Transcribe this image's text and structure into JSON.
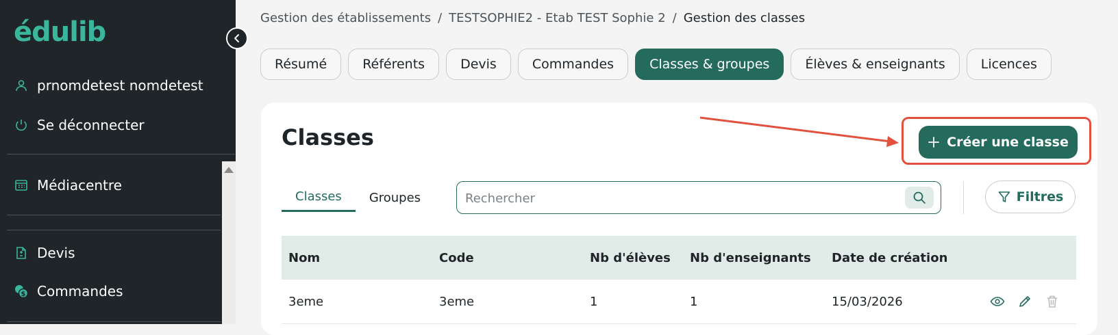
{
  "sidebar": {
    "logo": "édulib",
    "user": "prnomdetest nomdetest",
    "logout": "Se déconnecter",
    "items": [
      {
        "label": "Médiacentre",
        "icon": "catalog-icon"
      },
      {
        "label": "Devis",
        "icon": "quote-document-icon"
      },
      {
        "label": "Commandes",
        "icon": "coins-icon"
      }
    ]
  },
  "breadcrumb": [
    "Gestion des établissements",
    "/",
    "TESTSOPHIE2 - Etab TEST Sophie 2",
    "/",
    "Gestion des classes"
  ],
  "tabs": [
    "Résumé",
    "Référents",
    "Devis",
    "Commandes",
    "Classes & groupes",
    "Élèves & enseignants",
    "Licences"
  ],
  "active_tab": "Classes & groupes",
  "card": {
    "title": "Classes",
    "create_button": "Créer une classe",
    "subtabs": [
      "Classes",
      "Groupes"
    ],
    "search_placeholder": "Rechercher",
    "filter_button": "Filtres"
  },
  "table": {
    "headers": [
      "Nom",
      "Code",
      "Nb d'élèves",
      "Nb d'enseignants",
      "Date de création"
    ],
    "rows": [
      [
        "3eme",
        "3eme",
        "1",
        "1",
        "15/03/2026"
      ]
    ]
  },
  "colors": {
    "primary": "#246b5d",
    "sidebar_bg": "#1f2528",
    "logo": "#3bb59c",
    "highlight": "#e2513e",
    "table_header_bg": "#e1ece9"
  }
}
